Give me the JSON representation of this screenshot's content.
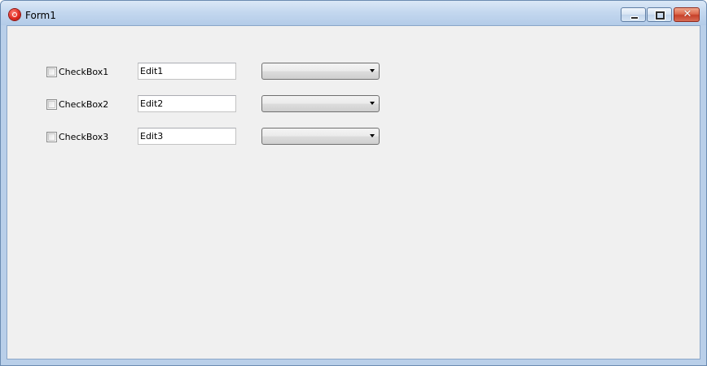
{
  "window": {
    "title": "Form1",
    "icon": "app-icon"
  },
  "caption_buttons": {
    "minimize_icon": "minimize-icon",
    "maximize_icon": "maximize-icon",
    "close_icon": "close-icon",
    "close_glyph": "✕"
  },
  "form": {
    "rows": [
      {
        "checkbox": {
          "label": "CheckBox1",
          "checked": false
        },
        "edit": {
          "value": "Edit1"
        },
        "combo": {
          "value": ""
        }
      },
      {
        "checkbox": {
          "label": "CheckBox2",
          "checked": false
        },
        "edit": {
          "value": "Edit2"
        },
        "combo": {
          "value": ""
        }
      },
      {
        "checkbox": {
          "label": "CheckBox3",
          "checked": false
        },
        "edit": {
          "value": "Edit3"
        },
        "combo": {
          "value": ""
        }
      }
    ]
  }
}
